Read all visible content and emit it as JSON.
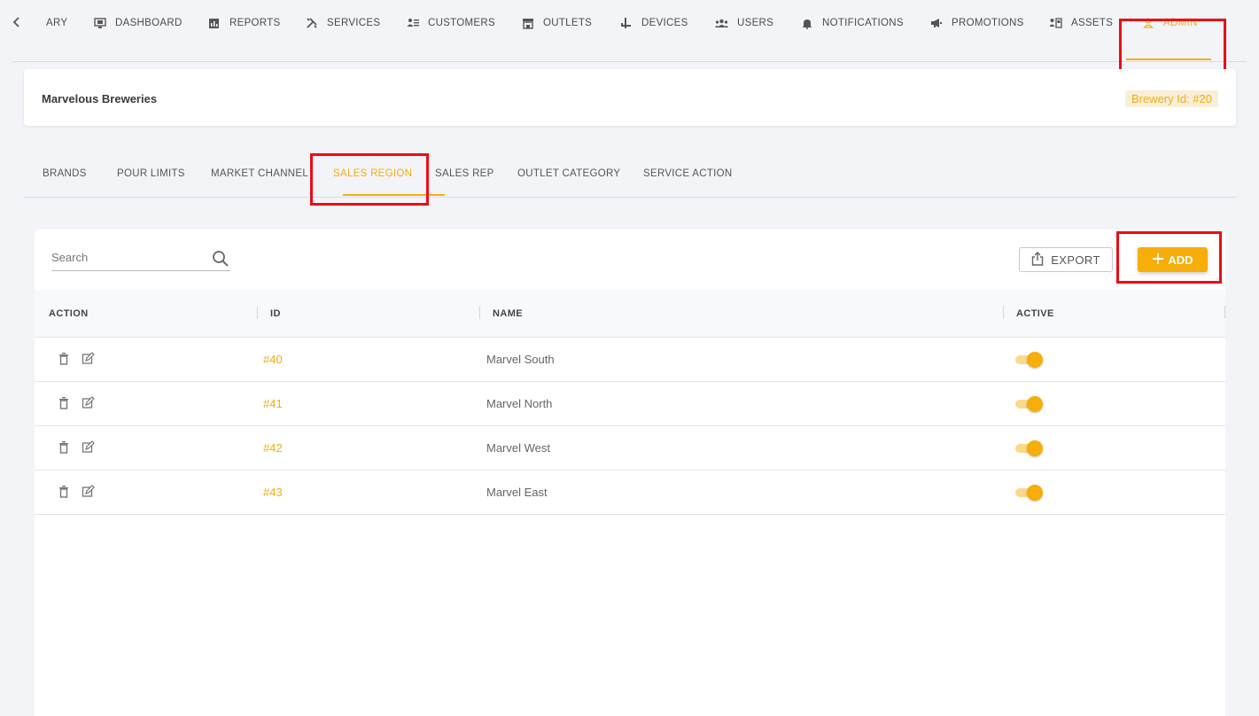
{
  "topnav": {
    "items": [
      {
        "label": "ARY",
        "icon": "library-icon"
      },
      {
        "label": "DASHBOARD",
        "icon": "monitor-icon"
      },
      {
        "label": "REPORTS",
        "icon": "report-icon"
      },
      {
        "label": "SERVICES",
        "icon": "tools-icon"
      },
      {
        "label": "CUSTOMERS",
        "icon": "customer-icon"
      },
      {
        "label": "OUTLETS",
        "icon": "store-icon"
      },
      {
        "label": "DEVICES",
        "icon": "tap-icon"
      },
      {
        "label": "USERS",
        "icon": "users-icon"
      },
      {
        "label": "NOTIFICATIONS",
        "icon": "bell-icon"
      },
      {
        "label": "PROMOTIONS",
        "icon": "megaphone-icon"
      },
      {
        "label": "ASSETS",
        "icon": "assets-icon"
      },
      {
        "label": "ADMIN",
        "icon": "person-icon",
        "active": true
      }
    ]
  },
  "brewery": {
    "name": "Marvelous Breweries",
    "id_label": "Brewery Id: #20"
  },
  "subtabs": [
    "BRANDS",
    "POUR LIMITS",
    "MARKET CHANNEL",
    "SALES REGION",
    "SALES REP",
    "OUTLET CATEGORY",
    "SERVICE ACTION"
  ],
  "active_subtab": "SALES REGION",
  "search": {
    "placeholder": "Search"
  },
  "toolbar": {
    "export_label": "EXPORT",
    "add_label": "ADD"
  },
  "table": {
    "columns": [
      "ACTION",
      "ID",
      "NAME",
      "ACTIVE"
    ],
    "rows": [
      {
        "id": "#40",
        "name": "Marvel South",
        "active": true
      },
      {
        "id": "#41",
        "name": "Marvel North",
        "active": true
      },
      {
        "id": "#42",
        "name": "Marvel West",
        "active": true
      },
      {
        "id": "#43",
        "name": "Marvel East",
        "active": true
      }
    ]
  },
  "colors": {
    "accent": "#f4ad0f",
    "highlight": "#ee0c13",
    "background": "#f3f4f8"
  }
}
